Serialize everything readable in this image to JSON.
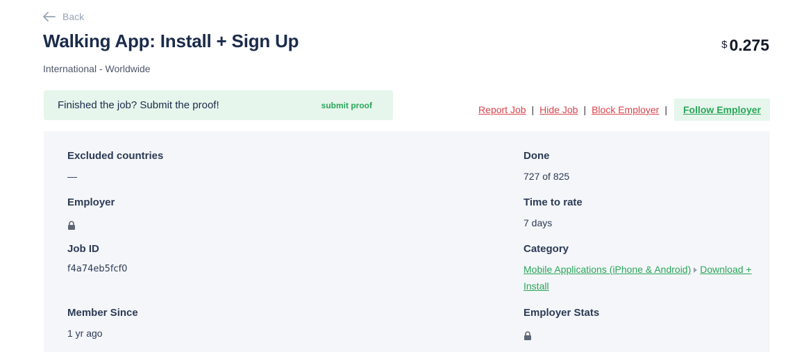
{
  "nav": {
    "back_label": "Back"
  },
  "job": {
    "title": "Walking App: Install + Sign Up",
    "region": "International - Worldwide",
    "price_currency": "$",
    "price_amount": "0.275"
  },
  "proof": {
    "text": "Finished the job? Submit the proof!",
    "submit_label": "submit proof"
  },
  "actions": {
    "report": "Report Job",
    "hide": "Hide Job",
    "block": "Block Employer",
    "follow": "Follow Employer",
    "separator": "|"
  },
  "details": {
    "excluded_countries": {
      "label": "Excluded countries",
      "value": "—"
    },
    "employer": {
      "label": "Employer",
      "value_icon": "lock-icon"
    },
    "job_id": {
      "label": "Job ID",
      "value": "f4a74eb5fcf0"
    },
    "member_since": {
      "label": "Member Since",
      "value": "1 yr ago"
    },
    "done": {
      "label": "Done",
      "value": "727 of 825"
    },
    "time_to_rate": {
      "label": "Time to rate",
      "value": "7 days"
    },
    "category": {
      "label": "Category",
      "primary": "Mobile Applications (iPhone & Android)",
      "secondary": "Download + Install"
    },
    "employer_stats": {
      "label": "Employer Stats",
      "value_icon": "lock-icon"
    }
  },
  "colors": {
    "accent_green": "#2aa55a",
    "danger_red": "#d9434b",
    "proof_bg": "#e6f6ec",
    "details_bg": "#f4f6f9",
    "title_navy": "#1b2b4b"
  }
}
